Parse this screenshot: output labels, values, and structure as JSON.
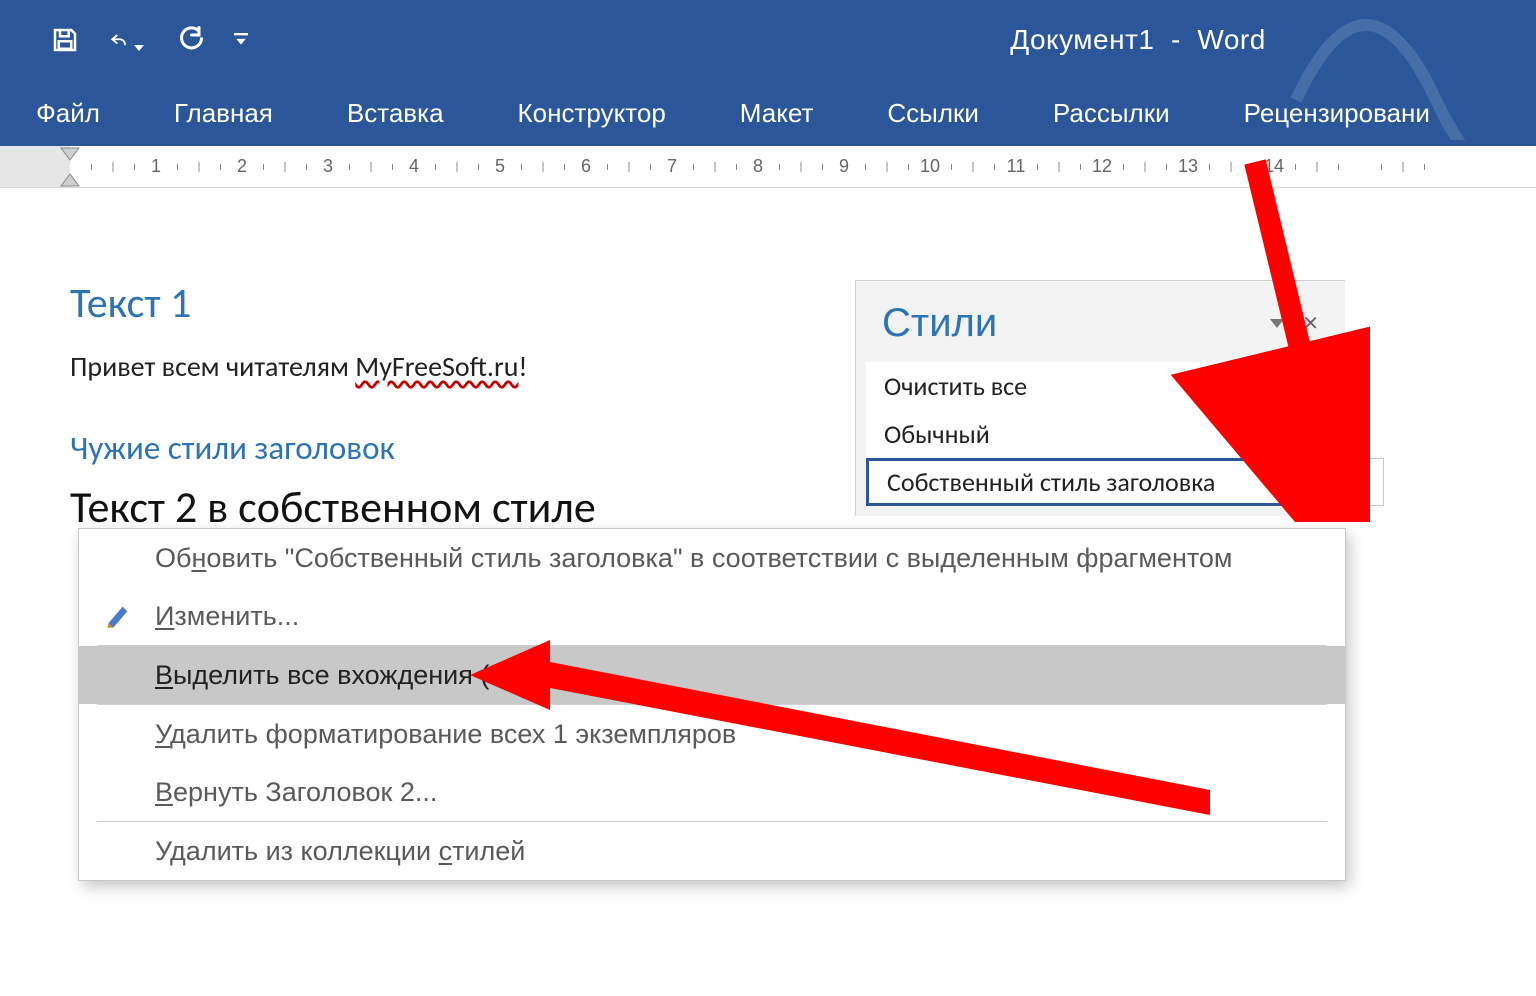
{
  "title": {
    "document": "Документ1",
    "sep": "-",
    "app": "Word"
  },
  "ribbon_tabs": [
    "Файл",
    "Главная",
    "Вставка",
    "Конструктор",
    "Макет",
    "Ссылки",
    "Рассылки",
    "Рецензировани"
  ],
  "ruler_numbers": [
    1,
    2,
    3,
    4,
    5,
    6,
    7,
    8,
    9,
    10,
    11,
    12,
    13,
    14
  ],
  "doc": {
    "h1": "Текст 1",
    "p_plain_before": "Привет всем читателям ",
    "p_misspelled": "MyFreeSoft.ru",
    "p_plain_after": "!",
    "h2a": "Чужие стили заголовок",
    "h2b": "Текст 2 в собственном стиле"
  },
  "styles_pane": {
    "title": "Стили",
    "items": [
      {
        "label": "Очистить все",
        "pilcrow": false
      },
      {
        "label": "Обычный",
        "pilcrow": true
      },
      {
        "label": "Собственный стиль заголовка",
        "pilcrow": true,
        "selected": true
      }
    ]
  },
  "ctx": {
    "update": "Обновить \"Собственный стиль заголовка\" в соответствии с выделенным фрагментом",
    "modify_prefix": "И",
    "modify_rest": "зменить...",
    "select_prefix": "В",
    "select_rest": "ыделить все вхождения (1)",
    "clearfmt_prefix": "У",
    "clearfmt_rest": "далить форматирование всех 1 экземпляров",
    "revert_prefix": "В",
    "revert_rest": "ернуть Заголовок 2...",
    "delete_before": "Удалить из коллекции ",
    "delete_u": "с",
    "delete_after": "тилей"
  },
  "colors": {
    "brand": "#2b579a",
    "accent_blue": "#2e74b5",
    "arrow": "#ff0000"
  }
}
